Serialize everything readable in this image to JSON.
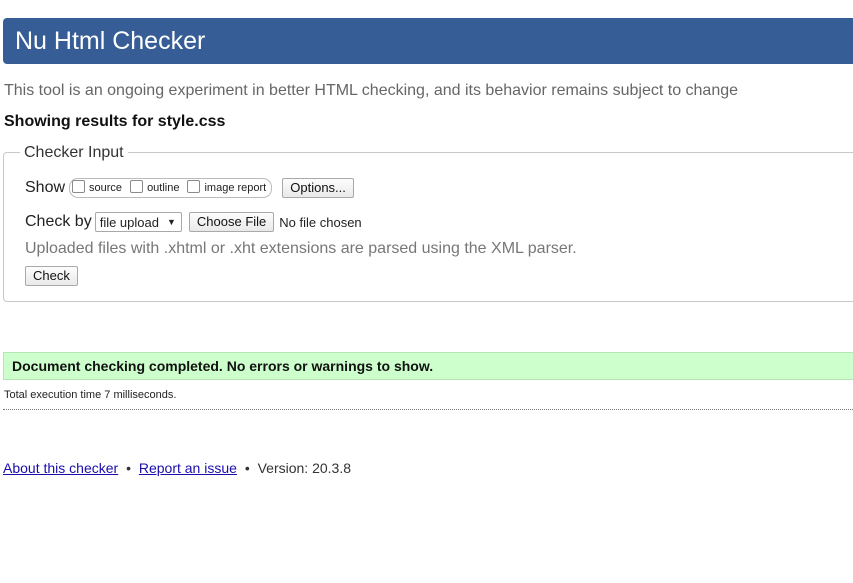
{
  "header": {
    "title": "Nu Html Checker"
  },
  "intro": {
    "text": "This tool is an ongoing experiment in better HTML checking, and its behavior remains subject to change"
  },
  "results_for": "Showing results for style.css",
  "checker_input": {
    "legend": "Checker Input",
    "show_label": "Show",
    "show_options": [
      {
        "label": "source",
        "checked": false
      },
      {
        "label": "outline",
        "checked": false
      },
      {
        "label": "image report",
        "checked": false
      }
    ],
    "options_button": "Options...",
    "check_by_label": "Check by",
    "check_by_selected": "file upload",
    "choose_file_button": "Choose File",
    "no_file_text": "No file chosen",
    "note": "Uploaded files with .xhtml or .xht extensions are parsed using the XML parser.",
    "check_button": "Check"
  },
  "result": {
    "message": "Document checking completed. No errors or warnings to show.",
    "exec_time": "Total execution time 7 milliseconds."
  },
  "footer": {
    "about_link": "About this checker",
    "separator": "•",
    "report_link": "Report an issue",
    "version_text": "Version: 20.3.8"
  },
  "colors": {
    "header_bg": "#365d95",
    "success_bg": "#ccffcc",
    "link": "#1a0dab"
  }
}
